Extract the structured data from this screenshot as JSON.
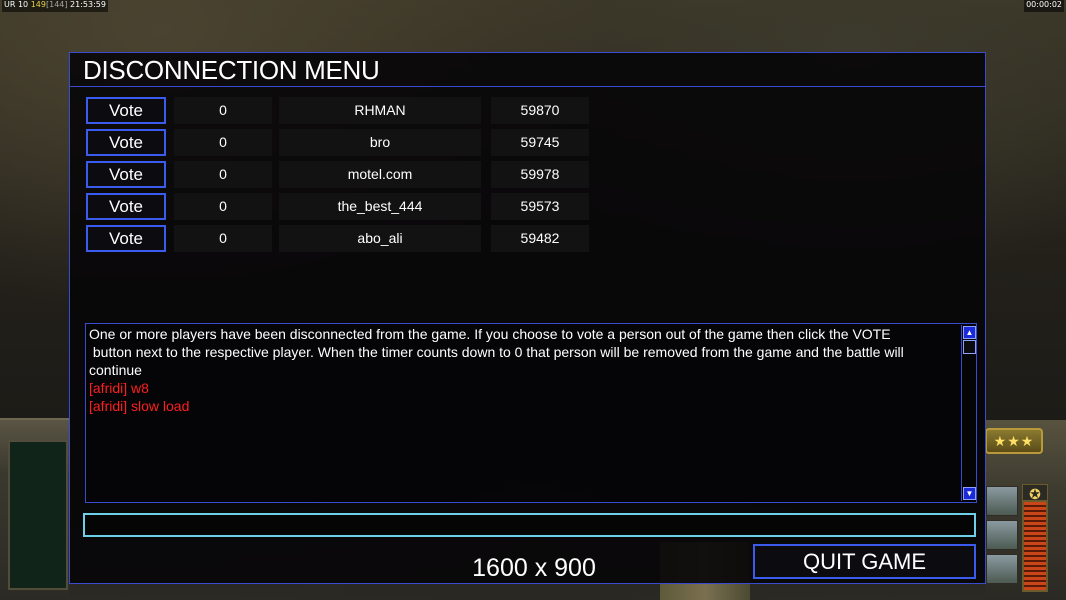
{
  "hud": {
    "label": "UR",
    "fps": "10",
    "frame": "149",
    "frame_cap": "[144]",
    "clock": "21:53:59",
    "game_timer": "00:00:02"
  },
  "dialog": {
    "title": "DISCONNECTION MENU",
    "players": [
      {
        "vote_label": "Vote",
        "votes": "0",
        "name": "RHMAN",
        "ping": "59870"
      },
      {
        "vote_label": "Vote",
        "votes": "0",
        "name": "bro",
        "ping": "59745"
      },
      {
        "vote_label": "Vote",
        "votes": "0",
        "name": "motel.com",
        "ping": "59978"
      },
      {
        "vote_label": "Vote",
        "votes": "0",
        "name": "the_best_444",
        "ping": "59573"
      },
      {
        "vote_label": "Vote",
        "votes": "0",
        "name": "abo_ali",
        "ping": "59482"
      }
    ],
    "messages": {
      "system_line1": "One or more players have been disconnected from the game. If you choose to vote a person out of the game then click the VOTE",
      "system_line2": " button next to the respective player. When the timer counts down to 0 that person will be removed from the game and the battle will",
      "system_line3": "continue",
      "chat": [
        "[afridi] w8",
        "[afridi] slow load"
      ]
    },
    "chat_input": {
      "value": "",
      "placeholder": ""
    },
    "resolution": "1600 x 900",
    "quit_label": "QUIT GAME"
  },
  "colors": {
    "border": "#3a4bd0",
    "button_border": "#3b5bef",
    "input_border": "#6ed0e8",
    "chat_red": "#ff1e1e"
  },
  "icons": {
    "scroll_up": "scroll-up-arrow-icon",
    "scroll_down": "scroll-down-arrow-icon",
    "rank": "rank-stars-icon"
  }
}
